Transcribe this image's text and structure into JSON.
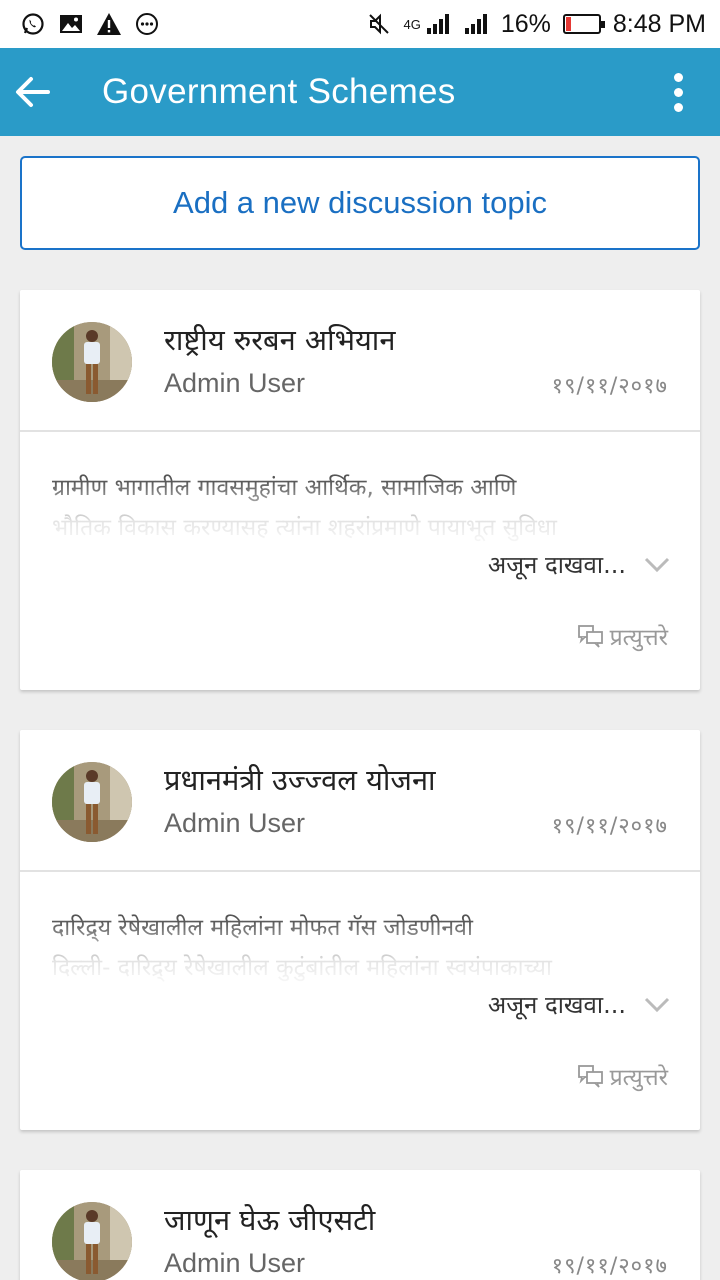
{
  "status_bar": {
    "icons_left": [
      "whatsapp-icon",
      "image-icon",
      "warning-icon",
      "more-horizontal-icon"
    ],
    "network": "4G",
    "battery_percent": "16%",
    "battery_level": 0.16,
    "time": "8:48 PM"
  },
  "app_bar": {
    "title": "Government Schemes"
  },
  "add_topic_label": "Add a new discussion topic",
  "topics": [
    {
      "title": "राष्ट्रीय रुरबन अभियान",
      "author": "Admin User",
      "date": "१९/११/२०१७",
      "excerpt_line1": "ग्रामीण भागातील गावसमुहांचा आर्थिक, सामाजिक आणि",
      "excerpt_line2": "भौतिक विकास करण्यासह त्यांना शहरांप्रमाणे पायाभूत सुविधा",
      "show_more": "अजून दाखवा...",
      "replies": "प्रत्युत्तरे"
    },
    {
      "title": "प्रधानमंत्री उज्ज्वल योजना",
      "author": "Admin User",
      "date": "१९/११/२०१७",
      "excerpt_line1": "दारिद्र्य रेषेखालील महिलांना मोफत गॅस जोडणीनवी",
      "excerpt_line2": "दिल्ली- दारिद्र्य रेषेखालील कुटुंबांतील महिलांना स्वयंपाकाच्या",
      "show_more": "अजून दाखवा...",
      "replies": "प्रत्युत्तरे"
    },
    {
      "title": "जाणून घेऊ जीएसटी",
      "author": "Admin User",
      "date": "१९/११/२०१७"
    }
  ]
}
